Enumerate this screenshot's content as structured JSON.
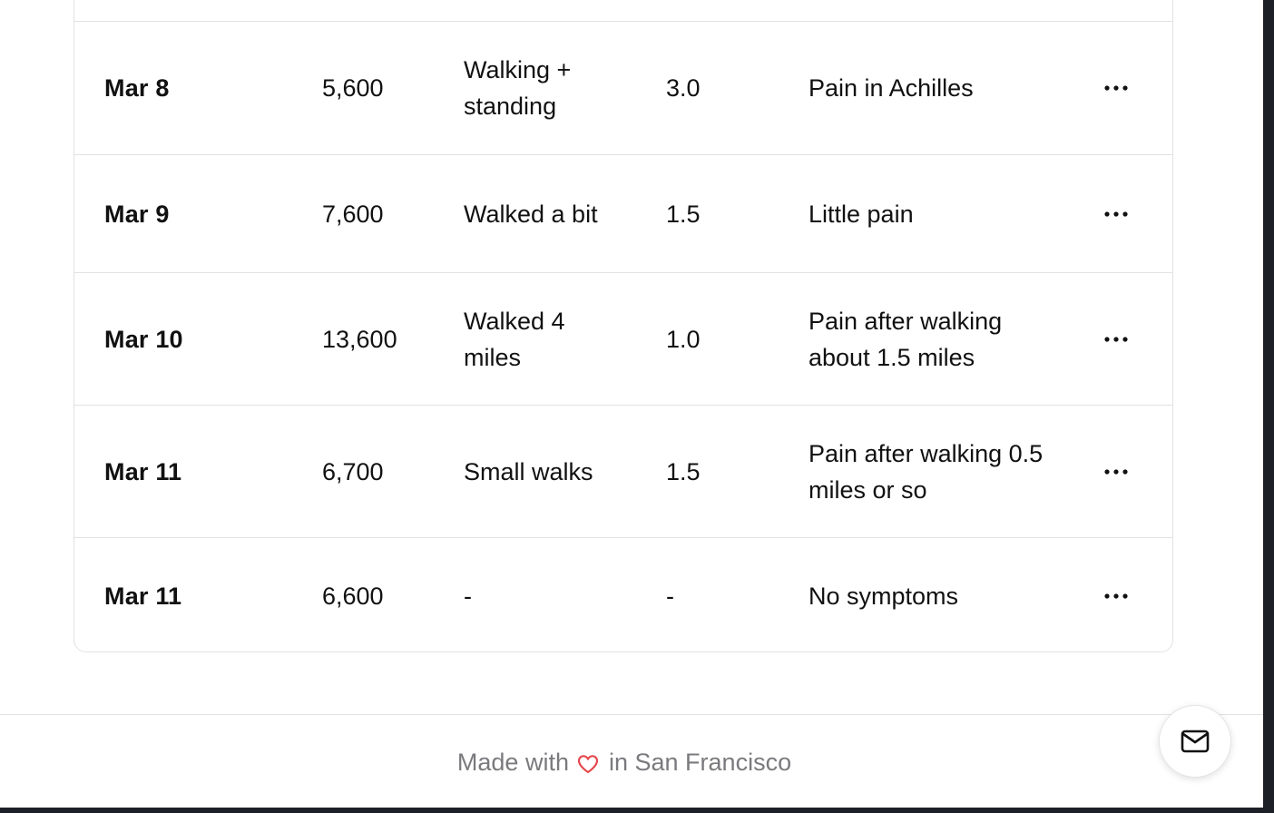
{
  "table": {
    "rows": [
      {
        "date": "Mar 8",
        "steps": "5,600",
        "activity": "Walking + standing",
        "pain": "3.0",
        "notes": "Pain in Achilles"
      },
      {
        "date": "Mar 9",
        "steps": "7,600",
        "activity": "Walked a bit",
        "pain": "1.5",
        "notes": "Little pain"
      },
      {
        "date": "Mar 10",
        "steps": "13,600",
        "activity": "Walked 4 miles",
        "pain": "1.0",
        "notes": "Pain after walking about 1.5 miles"
      },
      {
        "date": "Mar 11",
        "steps": "6,700",
        "activity": "Small walks",
        "pain": "1.5",
        "notes": "Pain after walking 0.5 miles or so"
      },
      {
        "date": "Mar 11",
        "steps": "6,600",
        "activity": "-",
        "pain": "-",
        "notes": "No symptoms"
      }
    ],
    "row_action_icon": "more-horizontal-icon"
  },
  "footer": {
    "before": "Made with",
    "after": "in San Francisco",
    "heart_icon": "heart-icon",
    "heart_color": "#e5484d"
  },
  "contact_button": {
    "icon": "mail-icon"
  }
}
